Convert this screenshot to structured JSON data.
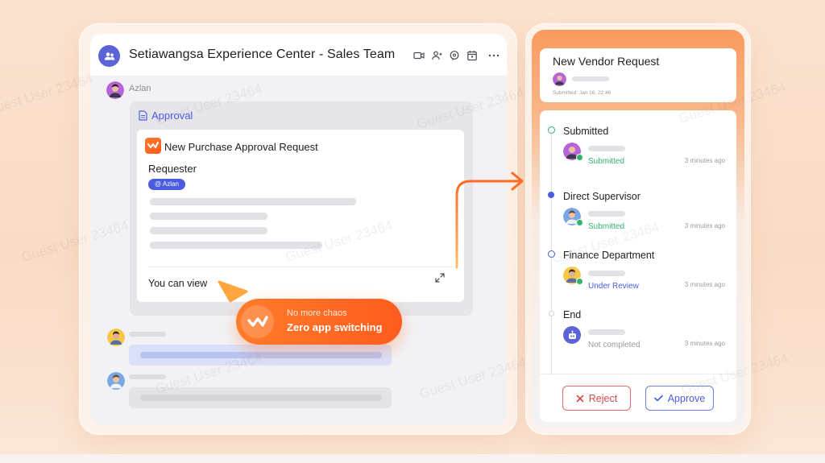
{
  "chat": {
    "title": "Setiawangsa Experience Center - Sales Team",
    "sender": "Azlan",
    "approval_tag": "Approval",
    "request_title": "New Purchase Approval Request",
    "requester_label": "Requester",
    "mention": "@ Azlan",
    "view_text": "You can view"
  },
  "badge": {
    "subtitle": "No more chaos",
    "main": "Zero app switching"
  },
  "vendor": {
    "title": "New Vendor Request",
    "submitted": "Submitted: Jan 16, 22:46"
  },
  "timeline": [
    {
      "title": "Submitted",
      "status": "Submitted",
      "time": "3 minutes ago",
      "status_color": "#33b26b"
    },
    {
      "title": "Direct Supervisor",
      "status": "Submitted",
      "time": "3 minutes ago",
      "status_color": "#33b26b"
    },
    {
      "title": "Finance Department",
      "status": "Under Review",
      "time": "3 minutes ago",
      "status_color": "#4a5ce0"
    },
    {
      "title": "End",
      "status": "Not completed",
      "time": "3 minutes ago",
      "status_color": "#9a9aa2"
    }
  ],
  "actions": {
    "reject": "Reject",
    "approve": "Approve"
  },
  "watermark": "Guest User 23464",
  "colors": {
    "accent_orange": "#ff6a24",
    "brand_blue": "#4a5ce0",
    "success_green": "#33b26b",
    "danger_red": "#d94848"
  },
  "icons": [
    "team-icon",
    "video-icon",
    "add-user-icon",
    "mention-icon",
    "calendar-icon",
    "more-icon",
    "document-icon",
    "expand-icon",
    "x-icon",
    "check-icon",
    "robot-icon"
  ]
}
